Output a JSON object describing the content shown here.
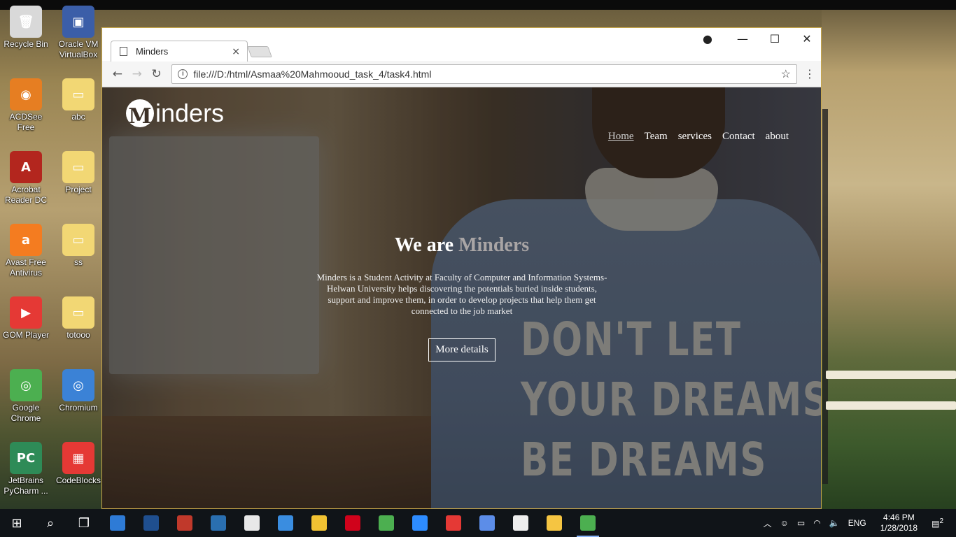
{
  "desktop": {
    "icons": [
      {
        "label": "Recycle Bin",
        "glyph": "🗑"
      },
      {
        "label": "Oracle VM VirtualBox",
        "glyph": "▣"
      },
      {
        "label": "ACDSee Free",
        "glyph": "◉"
      },
      {
        "label": "abc",
        "glyph": "▭"
      },
      {
        "label": "Acrobat Reader DC",
        "glyph": "A"
      },
      {
        "label": "Project",
        "glyph": "▭"
      },
      {
        "label": "Avast Free Antivirus",
        "glyph": "a"
      },
      {
        "label": "ss",
        "glyph": "▭"
      },
      {
        "label": "GOM Player",
        "glyph": "▶"
      },
      {
        "label": "totooo",
        "glyph": "▭"
      },
      {
        "label": "Google Chrome",
        "glyph": "◎"
      },
      {
        "label": "Chromium",
        "glyph": "◎"
      },
      {
        "label": "JetBrains PyCharm ...",
        "glyph": "PC"
      },
      {
        "label": "CodeBlocks",
        "glyph": "▦"
      }
    ]
  },
  "browser": {
    "tab_title": "Minders",
    "tab_close": "×",
    "url": "file:///D:/html/Asmaa%20Mahmooud_task_4/task4.html",
    "controls": {
      "account": "●",
      "minimize": "—",
      "maximize": "☐",
      "close": "✕"
    },
    "nav": {
      "back": "←",
      "forward": "→",
      "reload": "↻",
      "star": "☆",
      "menu": "⋮",
      "info": "i"
    }
  },
  "site": {
    "logo_mark": "M",
    "logo_text": "inders",
    "nav": [
      "Home",
      "Team",
      "services",
      "Contact",
      "about"
    ],
    "hero_title_1": "We are",
    "hero_title_2": "Minders",
    "hero_text": "Minders is a Student Activity at Faculty of Computer and Information Systems-Helwan University helps discovering the potentials buried inside students, support and improve them, in order to develop projects that help them get connected to the job market",
    "hero_button": "More details",
    "shirt_lines": [
      "DON'T LET",
      "YOUR DREAMS",
      "BE DREAMS"
    ]
  },
  "taskbar": {
    "start": "⊞",
    "search": "⌕",
    "taskview": "❐",
    "apps": [
      {
        "name": "app-1",
        "color": "#2e7bd6",
        "open": false
      },
      {
        "name": "app-2",
        "color": "#1f4f8f",
        "open": false
      },
      {
        "name": "app-3",
        "color": "#c0392b",
        "open": false
      },
      {
        "name": "app-4",
        "color": "#2a6fb0",
        "open": false
      },
      {
        "name": "app-5",
        "color": "#e8e8e8",
        "open": false
      },
      {
        "name": "app-6",
        "color": "#3a8de0",
        "open": false
      },
      {
        "name": "app-7",
        "color": "#f1c232",
        "open": false
      },
      {
        "name": "app-8",
        "color": "#d0021b",
        "open": false
      },
      {
        "name": "app-9",
        "color": "#4caf50",
        "open": false
      },
      {
        "name": "app-10",
        "color": "#2d8cff",
        "open": false
      },
      {
        "name": "app-11",
        "color": "#e53935",
        "open": false
      },
      {
        "name": "app-12",
        "color": "#5c8de8",
        "open": false
      },
      {
        "name": "app-13",
        "color": "#eeeeee",
        "open": false
      },
      {
        "name": "app-14",
        "color": "#f5c542",
        "open": false
      },
      {
        "name": "app-15",
        "color": "#4caf50",
        "open": true
      }
    ],
    "tray": {
      "lang": "ENG",
      "time": "4:46 PM",
      "date": "1/28/2018",
      "notif": "2"
    }
  }
}
